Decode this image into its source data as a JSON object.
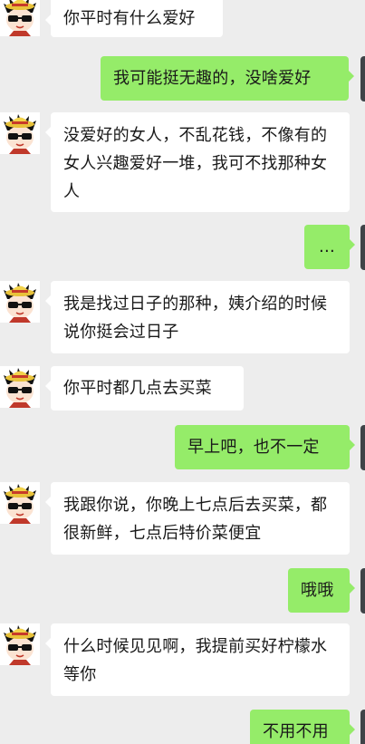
{
  "messages": [
    {
      "side": "in",
      "text": "你平时有什么爱好"
    },
    {
      "side": "out",
      "text": "我可能挺无趣的，没啥爱好"
    },
    {
      "side": "in",
      "text": "没爱好的女人，不乱花钱，不像有的女人兴趣爱好一堆，我可不找那种女人"
    },
    {
      "side": "out",
      "text": "…"
    },
    {
      "side": "in",
      "text": "我是找过日子的那种，姨介绍的时候说你挺会过日子"
    },
    {
      "side": "in",
      "text": "你平时都几点去买菜"
    },
    {
      "side": "out",
      "text": "早上吧，也不一定"
    },
    {
      "side": "in",
      "text": "我跟你说，你晚上七点后去买菜，都很新鲜，七点后特价菜便宜"
    },
    {
      "side": "out",
      "text": "哦哦"
    },
    {
      "side": "in",
      "text": "什么时候见见啊，我提前买好柠檬水等你"
    },
    {
      "side": "out",
      "text": "不用不用"
    }
  ],
  "colors": {
    "background": "#ededed",
    "incoming_bubble": "#ffffff",
    "outgoing_bubble": "#95ec69"
  },
  "icons": {
    "contact_avatar": "cartoon-boy-with-straw-hat-and-sunglasses"
  }
}
